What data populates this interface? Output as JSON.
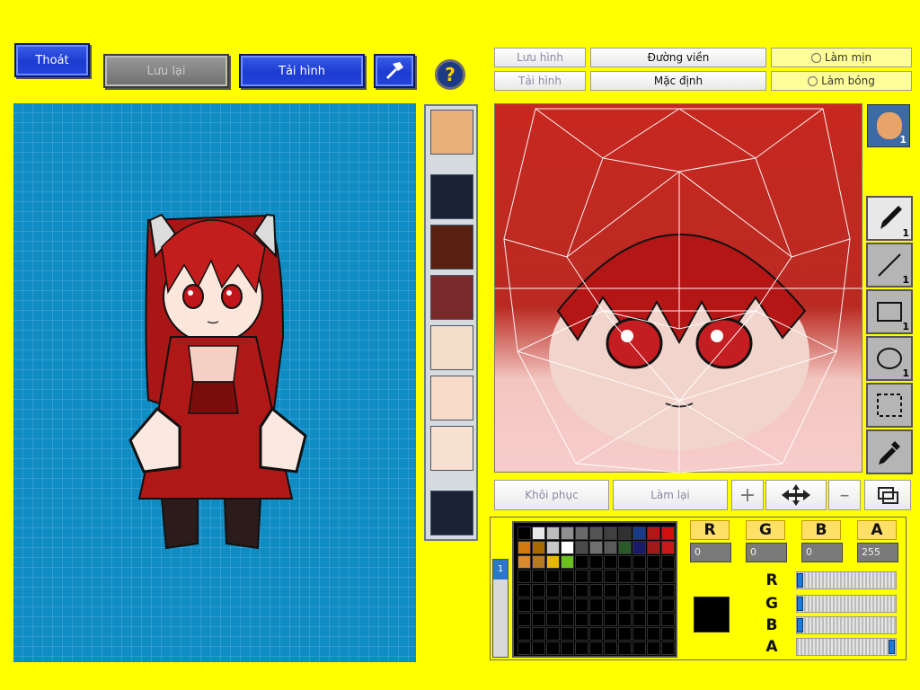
{
  "toolbar": {
    "exit_label": "Thoát",
    "save_label": "Lưu lại",
    "reload_label": "Tải hình"
  },
  "editor_tabs": {
    "save_image": "Lưu hình",
    "outline": "Đường viền",
    "smooth": "Làm mịn",
    "reload_image": "Tải hình",
    "default": "Mặc định",
    "shade": "Làm bóng"
  },
  "layer_badge": "1",
  "tools": [
    {
      "name": "brush",
      "badge": "1"
    },
    {
      "name": "line",
      "badge": "1"
    },
    {
      "name": "rectangle",
      "badge": "1"
    },
    {
      "name": "ellipse",
      "badge": "1"
    },
    {
      "name": "select",
      "badge": ""
    },
    {
      "name": "eyedropper",
      "badge": ""
    }
  ],
  "actions": {
    "restore": "Khôi phục",
    "redo": "Làm lại"
  },
  "color": {
    "r_label": "R",
    "g_label": "G",
    "b_label": "B",
    "a_label": "A",
    "r": "0",
    "g": "0",
    "b": "0",
    "a": "255",
    "current_hex": "#000000",
    "palette_tab": "1"
  },
  "palette": [
    "#000000",
    "#e8e8e8",
    "#bdbdbd",
    "#909090",
    "#6a6a6a",
    "#545454",
    "#404040",
    "#303030",
    "#1a3a8a",
    "#b01818",
    "#d21010",
    "#d07a10",
    "#a86a00",
    "#c8c8c8",
    "#ffffff",
    "#4a4a4a",
    "#707070",
    "#5a5a5a",
    "#2a5a2a",
    "#1a1a6a",
    "#a01a1a",
    "#c81a1a",
    "#d88a30",
    "#b87a20",
    "#e8b800",
    "#6ac020"
  ]
}
